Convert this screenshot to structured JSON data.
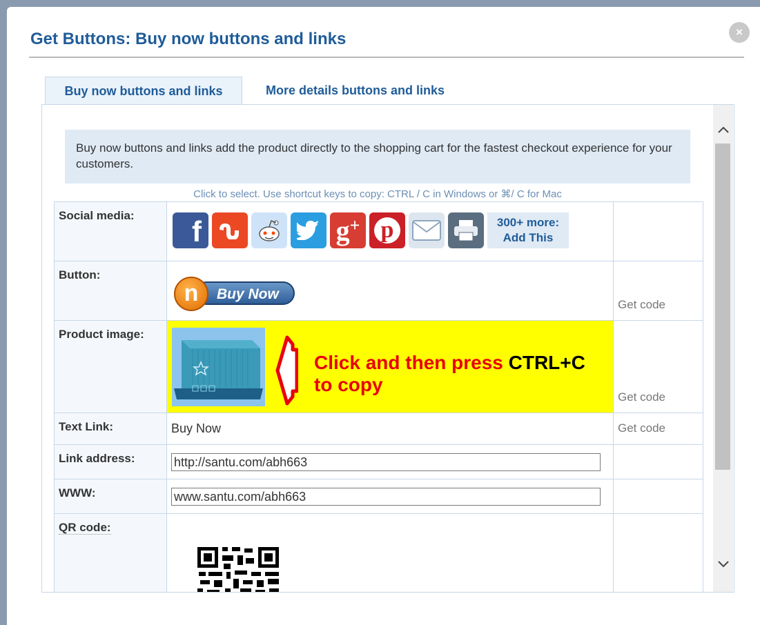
{
  "dialog": {
    "title": "Get Buttons: Buy now buttons and links",
    "close_label": "×"
  },
  "tabs": [
    {
      "label": "Buy now buttons and links",
      "active": true
    },
    {
      "label": "More details buttons and links",
      "active": false
    }
  ],
  "info": {
    "text": "Buy now buttons and links add the product directly to the shopping cart for the fastest checkout experience for your customers."
  },
  "hint": "Click to select. Use shortcut keys to copy: CTRL / C in Windows or ⌘/ C for Mac",
  "rows": {
    "social": {
      "label": "Social media:",
      "icons": [
        {
          "name": "facebook-icon",
          "glyph": "f",
          "color": "#3b5998"
        },
        {
          "name": "stumbleupon-icon",
          "glyph": "ꟊ",
          "color": "#eb4924"
        },
        {
          "name": "reddit-icon",
          "glyph": "☺",
          "color": "#cee3f8"
        },
        {
          "name": "twitter-icon",
          "glyph": "t",
          "color": "#2a9ee0"
        },
        {
          "name": "google-plus-icon",
          "glyph": "g+",
          "color": "#d73d32"
        },
        {
          "name": "pinterest-icon",
          "glyph": "p",
          "color": "#cb2027"
        },
        {
          "name": "email-icon",
          "glyph": "✉",
          "color": "#dde6ee"
        },
        {
          "name": "print-icon",
          "glyph": "⎙",
          "color": "#5a6e80"
        }
      ],
      "addthis_line1": "300+ more:",
      "addthis_line2": "Add This"
    },
    "button": {
      "label": "Button:",
      "buy_now_text": "Buy Now",
      "logo_letter": "n",
      "get_code": "Get code"
    },
    "product_image": {
      "label": "Product image:",
      "copy_text_red": "Click and then press ",
      "copy_text_black": "CTRL+C",
      "copy_text_red2": "to copy",
      "get_code": "Get code"
    },
    "text_link": {
      "label": "Text Link:",
      "value": "Buy Now",
      "get_code": "Get code"
    },
    "link_address": {
      "label": "Link address:",
      "value": "http://santu.com/abh663"
    },
    "www": {
      "label": "WWW:",
      "value": "www.santu.com/abh663"
    },
    "qr": {
      "label": "QR code:"
    }
  },
  "colors": {
    "title": "#1f5c99",
    "highlight": "#ffff00",
    "copy_red": "#e8000d"
  }
}
